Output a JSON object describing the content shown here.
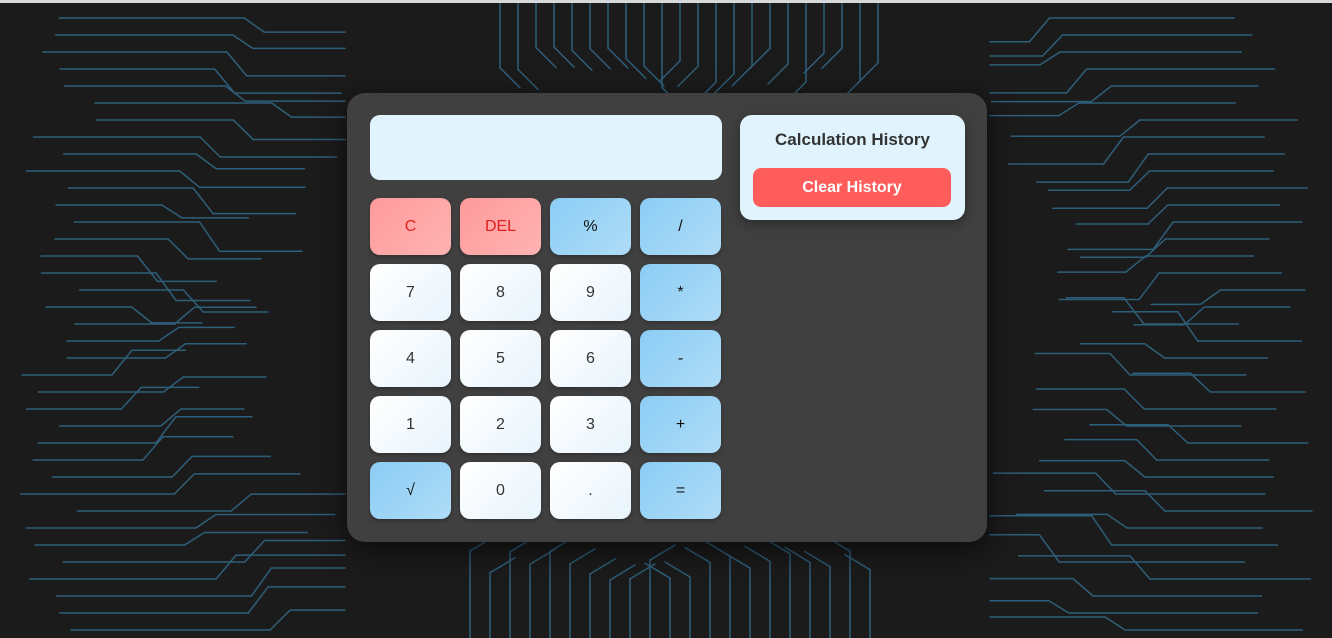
{
  "display": {
    "value": ""
  },
  "keys": [
    {
      "label": "C",
      "kind": "clr",
      "name": "clear-button"
    },
    {
      "label": "DEL",
      "kind": "clr",
      "name": "delete-button"
    },
    {
      "label": "%",
      "kind": "op",
      "name": "percent-button"
    },
    {
      "label": "/",
      "kind": "op",
      "name": "divide-button"
    },
    {
      "label": "7",
      "kind": "num",
      "name": "digit-7-button"
    },
    {
      "label": "8",
      "kind": "num",
      "name": "digit-8-button"
    },
    {
      "label": "9",
      "kind": "num",
      "name": "digit-9-button"
    },
    {
      "label": "*",
      "kind": "op",
      "name": "multiply-button"
    },
    {
      "label": "4",
      "kind": "num",
      "name": "digit-4-button"
    },
    {
      "label": "5",
      "kind": "num",
      "name": "digit-5-button"
    },
    {
      "label": "6",
      "kind": "num",
      "name": "digit-6-button"
    },
    {
      "label": "-",
      "kind": "op",
      "name": "subtract-button"
    },
    {
      "label": "1",
      "kind": "num",
      "name": "digit-1-button"
    },
    {
      "label": "2",
      "kind": "num",
      "name": "digit-2-button"
    },
    {
      "label": "3",
      "kind": "num",
      "name": "digit-3-button"
    },
    {
      "label": "+",
      "kind": "op",
      "name": "add-button"
    },
    {
      "label": "√",
      "kind": "op",
      "name": "square-root-button"
    },
    {
      "label": "0",
      "kind": "num",
      "name": "digit-0-button"
    },
    {
      "label": ".",
      "kind": "num",
      "name": "decimal-point-button"
    },
    {
      "label": "=",
      "kind": "op",
      "name": "equals-button"
    }
  ],
  "history": {
    "title": "Calculation History",
    "clear_label": "Clear History"
  },
  "colors": {
    "background": "#1b1b1b",
    "calculator_body": "#404040",
    "display": "#e1f4fd",
    "operator_key": "#8ccdf5",
    "clear_key": "#ff9a9a",
    "clear_history_button": "#ff5c5c",
    "circuit_glow": "#4fc3f7"
  }
}
